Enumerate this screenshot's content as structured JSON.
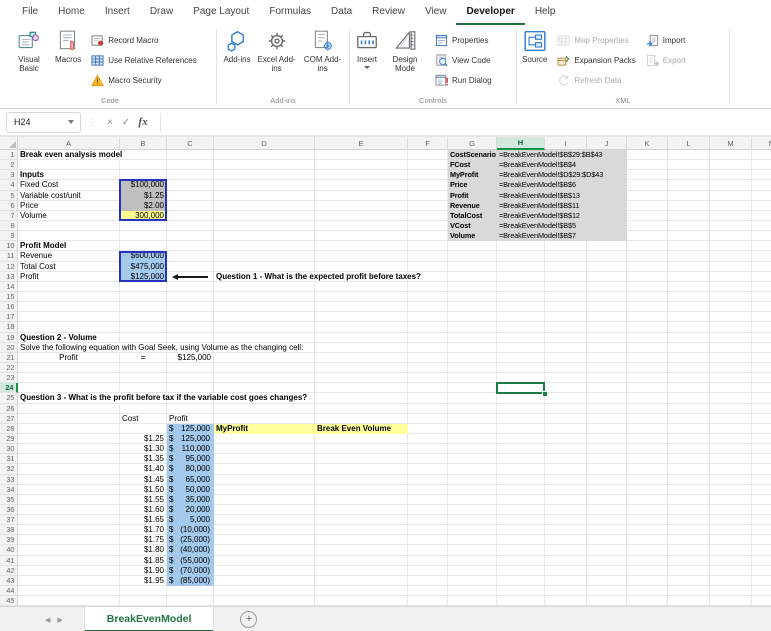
{
  "menu": {
    "tabs": [
      "File",
      "Home",
      "Insert",
      "Draw",
      "Page Layout",
      "Formulas",
      "Data",
      "Review",
      "View",
      "Developer",
      "Help"
    ],
    "active": "Developer"
  },
  "ribbon": {
    "code": {
      "group_label": "Code",
      "visual_basic": "Visual Basic",
      "macros": "Macros",
      "record_macro": "Record Macro",
      "use_relative_references": "Use Relative References",
      "macro_security": "Macro Security"
    },
    "addins": {
      "group_label": "Add-ins",
      "add_ins": "Add-ins",
      "excel_add_ins": "Excel Add-ins",
      "com_add_ins": "COM Add-ins"
    },
    "controls": {
      "group_label": "Controls",
      "insert": "Insert",
      "design_mode": "Design Mode",
      "properties": "Properties",
      "view_code": "View Code",
      "run_dialog": "Run Dialog"
    },
    "xml": {
      "group_label": "XML",
      "source": "Source",
      "map_properties": "Map Properties",
      "expansion_packs": "Expansion Packs",
      "refresh_data": "Refresh Data",
      "import": "Import",
      "export": "Export"
    }
  },
  "formula_bar": {
    "name_box": "H24",
    "formula": "",
    "fx_label": "fx",
    "cancel_glyph": "×",
    "enter_glyph": "✓"
  },
  "colors": {
    "accent_green": "#1e7145",
    "outline_blue": "#2633c0",
    "fill_gray": "#bfbfbf",
    "fill_yellow": "#ffff8f",
    "fill_blue": "#a3c9ec",
    "fill_band": "#ffff9e",
    "fill_names": "#d9d9d9"
  },
  "sheet": {
    "columns": [
      "A",
      "B",
      "C",
      "D",
      "E",
      "F",
      "G",
      "H",
      "I",
      "J",
      "K",
      "L",
      "M",
      "N"
    ],
    "visible_rows": 46,
    "selected_cell": "H24",
    "gray_region": "G1:J9",
    "outlines": [
      "B4:B7",
      "B11:B13"
    ],
    "arrow": {
      "row": 13
    },
    "cells": {
      "A1": {
        "t": "Break even analysis model",
        "b": 1,
        "sp": 1
      },
      "A3": {
        "t": "Inputs",
        "b": 1
      },
      "A4": {
        "t": "Fixed Cost"
      },
      "B4": {
        "t": "$100,000",
        "a": "r",
        "f": "gray"
      },
      "A5": {
        "t": "Variable cost/unit"
      },
      "B5": {
        "t": "$1.25",
        "a": "r",
        "f": "gray"
      },
      "A6": {
        "t": "Price"
      },
      "B6": {
        "t": "$2.00",
        "a": "r",
        "f": "gray"
      },
      "A7": {
        "t": "Volume"
      },
      "B7": {
        "t": "300,000",
        "a": "r",
        "f": "yellow"
      },
      "A10": {
        "t": "Profit Model",
        "b": 1
      },
      "A11": {
        "t": "Revenue"
      },
      "B11": {
        "t": "$600,000",
        "a": "r",
        "f": "blue"
      },
      "A12": {
        "t": "Total Cost"
      },
      "B12": {
        "t": "$475,000",
        "a": "r",
        "f": "blue"
      },
      "A13": {
        "t": "Profit"
      },
      "B13": {
        "t": "$125,000",
        "a": "r",
        "f": "blue"
      },
      "D13": {
        "t": "Question 1 - What is the expected profit before taxes?",
        "b": 1,
        "sp": 1
      },
      "A19": {
        "t": "Question 2 - Volume",
        "b": 1
      },
      "A20": {
        "t": "Solve the following equation with Goal Seek, using Volume as the changing cell:",
        "sp": 1
      },
      "A21": {
        "t": "Profit",
        "a": "c"
      },
      "B21": {
        "t": "=",
        "a": "c"
      },
      "C21": {
        "t": "$125,000",
        "a": "r"
      },
      "A25": {
        "t": "Question 3 - What is the profit before tax if the variable cost goes changes?",
        "b": 1,
        "sp": 1
      },
      "B27": {
        "t": "Cost"
      },
      "C27": {
        "t": "Profit"
      },
      "C28": {
        "acc": "125,000",
        "f": "blue"
      },
      "D28": {
        "t": "MyProfit",
        "b": 1,
        "f": "band"
      },
      "E28": {
        "t": "Break Even Volume",
        "b": 1,
        "f": "band"
      },
      "B29": {
        "t": "$1.25",
        "a": "r"
      },
      "C29": {
        "acc": "125,000",
        "f": "blue"
      },
      "B30": {
        "t": "$1.30",
        "a": "r"
      },
      "C30": {
        "acc": "110,000",
        "f": "blue"
      },
      "B31": {
        "t": "$1.35",
        "a": "r"
      },
      "C31": {
        "acc": "95,000",
        "f": "blue"
      },
      "B32": {
        "t": "$1.40",
        "a": "r"
      },
      "C32": {
        "acc": "80,000",
        "f": "blue"
      },
      "B33": {
        "t": "$1.45",
        "a": "r"
      },
      "C33": {
        "acc": "65,000",
        "f": "blue"
      },
      "B34": {
        "t": "$1.50",
        "a": "r"
      },
      "C34": {
        "acc": "50,000",
        "f": "blue"
      },
      "B35": {
        "t": "$1.55",
        "a": "r"
      },
      "C35": {
        "acc": "35,000",
        "f": "blue"
      },
      "B36": {
        "t": "$1.60",
        "a": "r"
      },
      "C36": {
        "acc": "20,000",
        "f": "blue"
      },
      "B37": {
        "t": "$1.65",
        "a": "r"
      },
      "C37": {
        "acc": "5,000",
        "f": "blue"
      },
      "B38": {
        "t": "$1.70",
        "a": "r"
      },
      "C38": {
        "acc": "(10,000)",
        "f": "blue"
      },
      "B39": {
        "t": "$1.75",
        "a": "r"
      },
      "C39": {
        "acc": "(25,000)",
        "f": "blue"
      },
      "B40": {
        "t": "$1.80",
        "a": "r"
      },
      "C40": {
        "acc": "(40,000)",
        "f": "blue"
      },
      "B41": {
        "t": "$1.85",
        "a": "r"
      },
      "C41": {
        "acc": "(55,000)",
        "f": "blue"
      },
      "B42": {
        "t": "$1.90",
        "a": "r"
      },
      "C42": {
        "acc": "(70,000)",
        "f": "blue"
      },
      "B43": {
        "t": "$1.95",
        "a": "r"
      },
      "C43": {
        "acc": "(85,000)",
        "f": "blue"
      },
      "G1": {
        "t": "CostScenario",
        "b": 1,
        "sm": 1
      },
      "H1": {
        "t": "=BreakEvenModel!$B$29:$B$43",
        "sm": 1,
        "sp": 1
      },
      "G2": {
        "t": "FCost",
        "b": 1,
        "sm": 1
      },
      "H2": {
        "t": "=BreakEvenModel!$B$4",
        "sm": 1,
        "sp": 1
      },
      "G3": {
        "t": "MyProfit",
        "b": 1,
        "sm": 1
      },
      "H3": {
        "t": "=BreakEvenModel!$D$29:$D$43",
        "sm": 1,
        "sp": 1
      },
      "G4": {
        "t": "Price",
        "b": 1,
        "sm": 1
      },
      "H4": {
        "t": "=BreakEvenModel!$B$6",
        "sm": 1,
        "sp": 1
      },
      "G5": {
        "t": "Profit",
        "b": 1,
        "sm": 1
      },
      "H5": {
        "t": "=BreakEvenModel!$B$13",
        "sm": 1,
        "sp": 1
      },
      "G6": {
        "t": "Revenue",
        "b": 1,
        "sm": 1
      },
      "H6": {
        "t": "=BreakEvenModel!$B$11",
        "sm": 1,
        "sp": 1
      },
      "G7": {
        "t": "TotalCost",
        "b": 1,
        "sm": 1
      },
      "H7": {
        "t": "=BreakEvenModel!$B$12",
        "sm": 1,
        "sp": 1
      },
      "G8": {
        "t": "VCost",
        "b": 1,
        "sm": 1
      },
      "H8": {
        "t": "=BreakEvenModel!$B$5",
        "sm": 1,
        "sp": 1
      },
      "G9": {
        "t": "Volume",
        "b": 1,
        "sm": 1
      },
      "H9": {
        "t": "=BreakEvenModel!$B$7",
        "sm": 1,
        "sp": 1
      }
    }
  },
  "tab_bar": {
    "sheet_name": "BreakEvenModel",
    "nav_left_glyph": "◀",
    "nav_right_glyph": "▶",
    "add_sheet_glyph": "+"
  }
}
